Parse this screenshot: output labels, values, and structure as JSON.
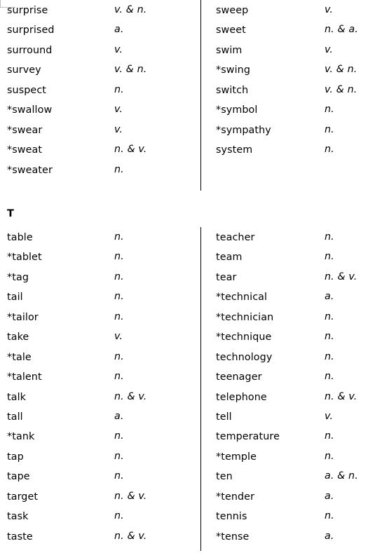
{
  "page": {
    "corner_mark": "page-corner-marker",
    "divider_color": "#000000",
    "text_color": "#000000",
    "corner_mark_color": "#bdbdbd"
  },
  "sections": [
    {
      "id": "section-s",
      "header": "",
      "has_header": false,
      "columns": [
        {
          "id": "s-left",
          "entries": [
            {
              "word": "surprise",
              "pos": "v. & n."
            },
            {
              "word": "surprised",
              "pos": "a."
            },
            {
              "word": "surround",
              "pos": "v."
            },
            {
              "word": "survey",
              "pos": "v. & n."
            },
            {
              "word": "suspect",
              "pos": "n."
            },
            {
              "word": "*swallow",
              "pos": "v."
            },
            {
              "word": "*swear",
              "pos": "v."
            },
            {
              "word": "*sweat",
              "pos": "n. & v."
            },
            {
              "word": "*sweater",
              "pos": "n."
            }
          ]
        },
        {
          "id": "s-right",
          "entries": [
            {
              "word": "sweep",
              "pos": "v."
            },
            {
              "word": "sweet",
              "pos": "n. & a."
            },
            {
              "word": "swim",
              "pos": "v."
            },
            {
              "word": "*swing",
              "pos": "v. & n."
            },
            {
              "word": "switch",
              "pos": "v. & n."
            },
            {
              "word": "*symbol",
              "pos": "n."
            },
            {
              "word": "*sympathy",
              "pos": "n."
            },
            {
              "word": "system",
              "pos": "n."
            }
          ]
        }
      ]
    },
    {
      "id": "section-t",
      "header": "T",
      "has_header": true,
      "columns": [
        {
          "id": "t-left",
          "entries": [
            {
              "word": "table",
              "pos": "n."
            },
            {
              "word": "*tablet",
              "pos": "n."
            },
            {
              "word": "*tag",
              "pos": "n."
            },
            {
              "word": "tail",
              "pos": "n."
            },
            {
              "word": "*tailor",
              "pos": "n."
            },
            {
              "word": "take",
              "pos": "v."
            },
            {
              "word": "*tale",
              "pos": "n."
            },
            {
              "word": "*talent",
              "pos": "n."
            },
            {
              "word": "talk",
              "pos": "n. & v."
            },
            {
              "word": "tall",
              "pos": "a."
            },
            {
              "word": "*tank",
              "pos": "n."
            },
            {
              "word": "tap",
              "pos": "n."
            },
            {
              "word": "tape",
              "pos": "n."
            },
            {
              "word": "target",
              "pos": "n. & v."
            },
            {
              "word": "task",
              "pos": "n."
            },
            {
              "word": "taste",
              "pos": "n. & v."
            }
          ]
        },
        {
          "id": "t-right",
          "entries": [
            {
              "word": "teacher",
              "pos": "n."
            },
            {
              "word": "team",
              "pos": "n."
            },
            {
              "word": "tear",
              "pos": "n. & v."
            },
            {
              "word": "*technical",
              "pos": "a."
            },
            {
              "word": "*technician",
              "pos": "n."
            },
            {
              "word": "*technique",
              "pos": "n."
            },
            {
              "word": "technology",
              "pos": "n."
            },
            {
              "word": "teenager",
              "pos": "n."
            },
            {
              "word": "telephone",
              "pos": "n. & v."
            },
            {
              "word": "tell",
              "pos": "v."
            },
            {
              "word": "temperature",
              "pos": "n."
            },
            {
              "word": "*temple",
              "pos": "n."
            },
            {
              "word": "ten",
              "pos": "a. & n."
            },
            {
              "word": "*tender",
              "pos": "a."
            },
            {
              "word": "tennis",
              "pos": "n."
            },
            {
              "word": "*tense",
              "pos": "a."
            }
          ]
        }
      ]
    }
  ]
}
